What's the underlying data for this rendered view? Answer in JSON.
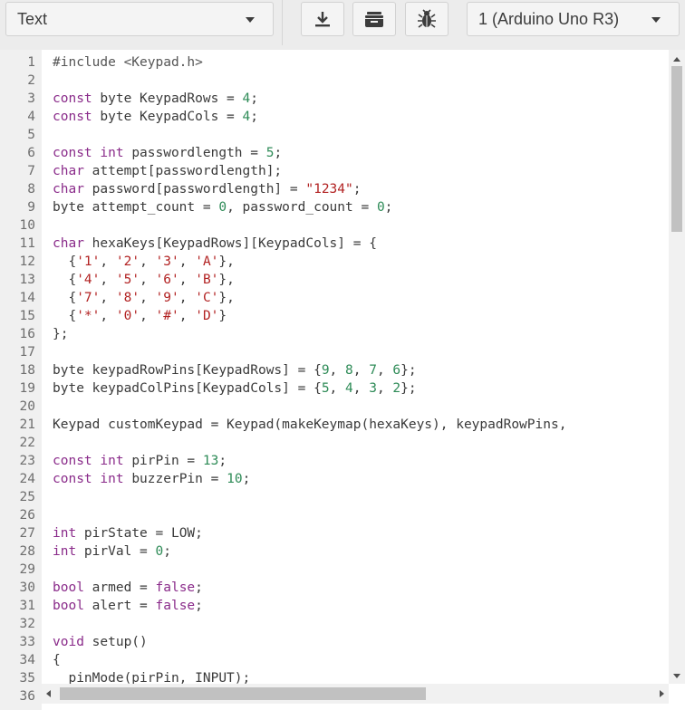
{
  "toolbar": {
    "mode": "Text",
    "board": "1 (Arduino Uno R3)",
    "icons": [
      "download-icon",
      "libraries-icon",
      "debugger-bug-icon"
    ]
  },
  "colors": {
    "keyword": "#8a2b8a",
    "number": "#2e8b57",
    "string": "#b22222",
    "text": "#3a3a3a",
    "line_number": "#6e6e6e"
  },
  "editor": {
    "lines": [
      {
        "n": "1",
        "tokens": [
          [
            "pp",
            "#include <Keypad.h>"
          ]
        ]
      },
      {
        "n": "2",
        "tokens": []
      },
      {
        "n": "3",
        "tokens": [
          [
            "kw",
            "const"
          ],
          [
            "plain",
            " byte KeypadRows = "
          ],
          [
            "num",
            "4"
          ],
          [
            "plain",
            ";"
          ]
        ]
      },
      {
        "n": "4",
        "tokens": [
          [
            "kw",
            "const"
          ],
          [
            "plain",
            " byte KeypadCols = "
          ],
          [
            "num",
            "4"
          ],
          [
            "plain",
            ";"
          ]
        ]
      },
      {
        "n": "5",
        "tokens": []
      },
      {
        "n": "6",
        "tokens": [
          [
            "kw",
            "const"
          ],
          [
            "plain",
            " "
          ],
          [
            "kw",
            "int"
          ],
          [
            "plain",
            " passwordlength = "
          ],
          [
            "num",
            "5"
          ],
          [
            "plain",
            ";"
          ]
        ]
      },
      {
        "n": "7",
        "tokens": [
          [
            "kw",
            "char"
          ],
          [
            "plain",
            " attempt[passwordlength];"
          ]
        ]
      },
      {
        "n": "8",
        "tokens": [
          [
            "kw",
            "char"
          ],
          [
            "plain",
            " password[passwordlength] = "
          ],
          [
            "str",
            "\"1234\""
          ],
          [
            "plain",
            ";"
          ]
        ]
      },
      {
        "n": "9",
        "tokens": [
          [
            "plain",
            "byte attempt_count = "
          ],
          [
            "num",
            "0"
          ],
          [
            "plain",
            ", password_count = "
          ],
          [
            "num",
            "0"
          ],
          [
            "plain",
            ";"
          ]
        ]
      },
      {
        "n": "10",
        "tokens": []
      },
      {
        "n": "11",
        "tokens": [
          [
            "kw",
            "char"
          ],
          [
            "plain",
            " hexaKeys[KeypadRows][KeypadCols] = {"
          ]
        ]
      },
      {
        "n": "12",
        "tokens": [
          [
            "plain",
            "  {"
          ],
          [
            "str",
            "'1'"
          ],
          [
            "plain",
            ", "
          ],
          [
            "str",
            "'2'"
          ],
          [
            "plain",
            ", "
          ],
          [
            "str",
            "'3'"
          ],
          [
            "plain",
            ", "
          ],
          [
            "str",
            "'A'"
          ],
          [
            "plain",
            "},"
          ]
        ]
      },
      {
        "n": "13",
        "tokens": [
          [
            "plain",
            "  {"
          ],
          [
            "str",
            "'4'"
          ],
          [
            "plain",
            ", "
          ],
          [
            "str",
            "'5'"
          ],
          [
            "plain",
            ", "
          ],
          [
            "str",
            "'6'"
          ],
          [
            "plain",
            ", "
          ],
          [
            "str",
            "'B'"
          ],
          [
            "plain",
            "},"
          ]
        ]
      },
      {
        "n": "14",
        "tokens": [
          [
            "plain",
            "  {"
          ],
          [
            "str",
            "'7'"
          ],
          [
            "plain",
            ", "
          ],
          [
            "str",
            "'8'"
          ],
          [
            "plain",
            ", "
          ],
          [
            "str",
            "'9'"
          ],
          [
            "plain",
            ", "
          ],
          [
            "str",
            "'C'"
          ],
          [
            "plain",
            "},"
          ]
        ]
      },
      {
        "n": "15",
        "tokens": [
          [
            "plain",
            "  {"
          ],
          [
            "str",
            "'*'"
          ],
          [
            "plain",
            ", "
          ],
          [
            "str",
            "'0'"
          ],
          [
            "plain",
            ", "
          ],
          [
            "str",
            "'#'"
          ],
          [
            "plain",
            ", "
          ],
          [
            "str",
            "'D'"
          ],
          [
            "plain",
            "}"
          ]
        ]
      },
      {
        "n": "16",
        "tokens": [
          [
            "plain",
            "};"
          ]
        ]
      },
      {
        "n": "17",
        "tokens": []
      },
      {
        "n": "18",
        "tokens": [
          [
            "plain",
            "byte keypadRowPins[KeypadRows] = {"
          ],
          [
            "num",
            "9"
          ],
          [
            "plain",
            ", "
          ],
          [
            "num",
            "8"
          ],
          [
            "plain",
            ", "
          ],
          [
            "num",
            "7"
          ],
          [
            "plain",
            ", "
          ],
          [
            "num",
            "6"
          ],
          [
            "plain",
            "};"
          ]
        ]
      },
      {
        "n": "19",
        "tokens": [
          [
            "plain",
            "byte keypadColPins[KeypadCols] = {"
          ],
          [
            "num",
            "5"
          ],
          [
            "plain",
            ", "
          ],
          [
            "num",
            "4"
          ],
          [
            "plain",
            ", "
          ],
          [
            "num",
            "3"
          ],
          [
            "plain",
            ", "
          ],
          [
            "num",
            "2"
          ],
          [
            "plain",
            "};"
          ]
        ]
      },
      {
        "n": "20",
        "tokens": []
      },
      {
        "n": "21",
        "tokens": [
          [
            "plain",
            "Keypad customKeypad = Keypad(makeKeymap(hexaKeys), keypadRowPins,"
          ]
        ]
      },
      {
        "n": "22",
        "tokens": []
      },
      {
        "n": "23",
        "tokens": [
          [
            "kw",
            "const"
          ],
          [
            "plain",
            " "
          ],
          [
            "kw",
            "int"
          ],
          [
            "plain",
            " pirPin = "
          ],
          [
            "num",
            "13"
          ],
          [
            "plain",
            ";"
          ]
        ]
      },
      {
        "n": "24",
        "tokens": [
          [
            "kw",
            "const"
          ],
          [
            "plain",
            " "
          ],
          [
            "kw",
            "int"
          ],
          [
            "plain",
            " buzzerPin = "
          ],
          [
            "num",
            "10"
          ],
          [
            "plain",
            ";"
          ]
        ]
      },
      {
        "n": "25",
        "tokens": []
      },
      {
        "n": "26",
        "tokens": []
      },
      {
        "n": "27",
        "tokens": [
          [
            "kw",
            "int"
          ],
          [
            "plain",
            " pirState = LOW;"
          ]
        ]
      },
      {
        "n": "28",
        "tokens": [
          [
            "kw",
            "int"
          ],
          [
            "plain",
            " pirVal = "
          ],
          [
            "num",
            "0"
          ],
          [
            "plain",
            ";"
          ]
        ]
      },
      {
        "n": "29",
        "tokens": []
      },
      {
        "n": "30",
        "tokens": [
          [
            "kw",
            "bool"
          ],
          [
            "plain",
            " armed = "
          ],
          [
            "kw",
            "false"
          ],
          [
            "plain",
            ";"
          ]
        ]
      },
      {
        "n": "31",
        "tokens": [
          [
            "kw",
            "bool"
          ],
          [
            "plain",
            " alert = "
          ],
          [
            "kw",
            "false"
          ],
          [
            "plain",
            ";"
          ]
        ]
      },
      {
        "n": "32",
        "tokens": []
      },
      {
        "n": "33",
        "tokens": [
          [
            "kw",
            "void"
          ],
          [
            "plain",
            " setup()"
          ]
        ]
      },
      {
        "n": "34",
        "tokens": [
          [
            "plain",
            "{"
          ]
        ]
      },
      {
        "n": "35",
        "tokens": [
          [
            "plain",
            "  pinMode(pirPin, INPUT);"
          ]
        ]
      },
      {
        "n": "36",
        "tokens": []
      }
    ]
  }
}
